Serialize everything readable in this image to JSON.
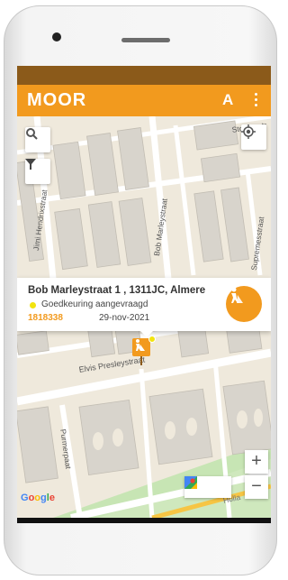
{
  "app": {
    "logo": "MOOR",
    "user_initial": "A"
  },
  "card": {
    "address": "Bob Marleystraat 1 , 1311JC, Almere",
    "status": "Goedkeuring aangevraagd",
    "id": "1818338",
    "date": "29-nov-2021"
  },
  "map": {
    "streets": {
      "jimi": "Jimi Hendrixstraat",
      "bob": "Bob Marleystraat",
      "supremes": "Supremesstraat",
      "elvis": "Elvis Presleystraat",
      "purmer": "Purmerpaat",
      "holla": "Holla",
      "stones": "Stones-str"
    },
    "attribution": "Google",
    "zoom_in": "+",
    "zoom_out": "−"
  },
  "colors": {
    "accent": "#f29a1e",
    "status_bar": "#8b5a1a",
    "status_pending": "#f2e40f"
  },
  "icons": [
    "search-icon",
    "filter-icon",
    "locate-icon",
    "worker-icon",
    "kebab-menu-icon",
    "directions-icon",
    "google-maps-icon"
  ]
}
